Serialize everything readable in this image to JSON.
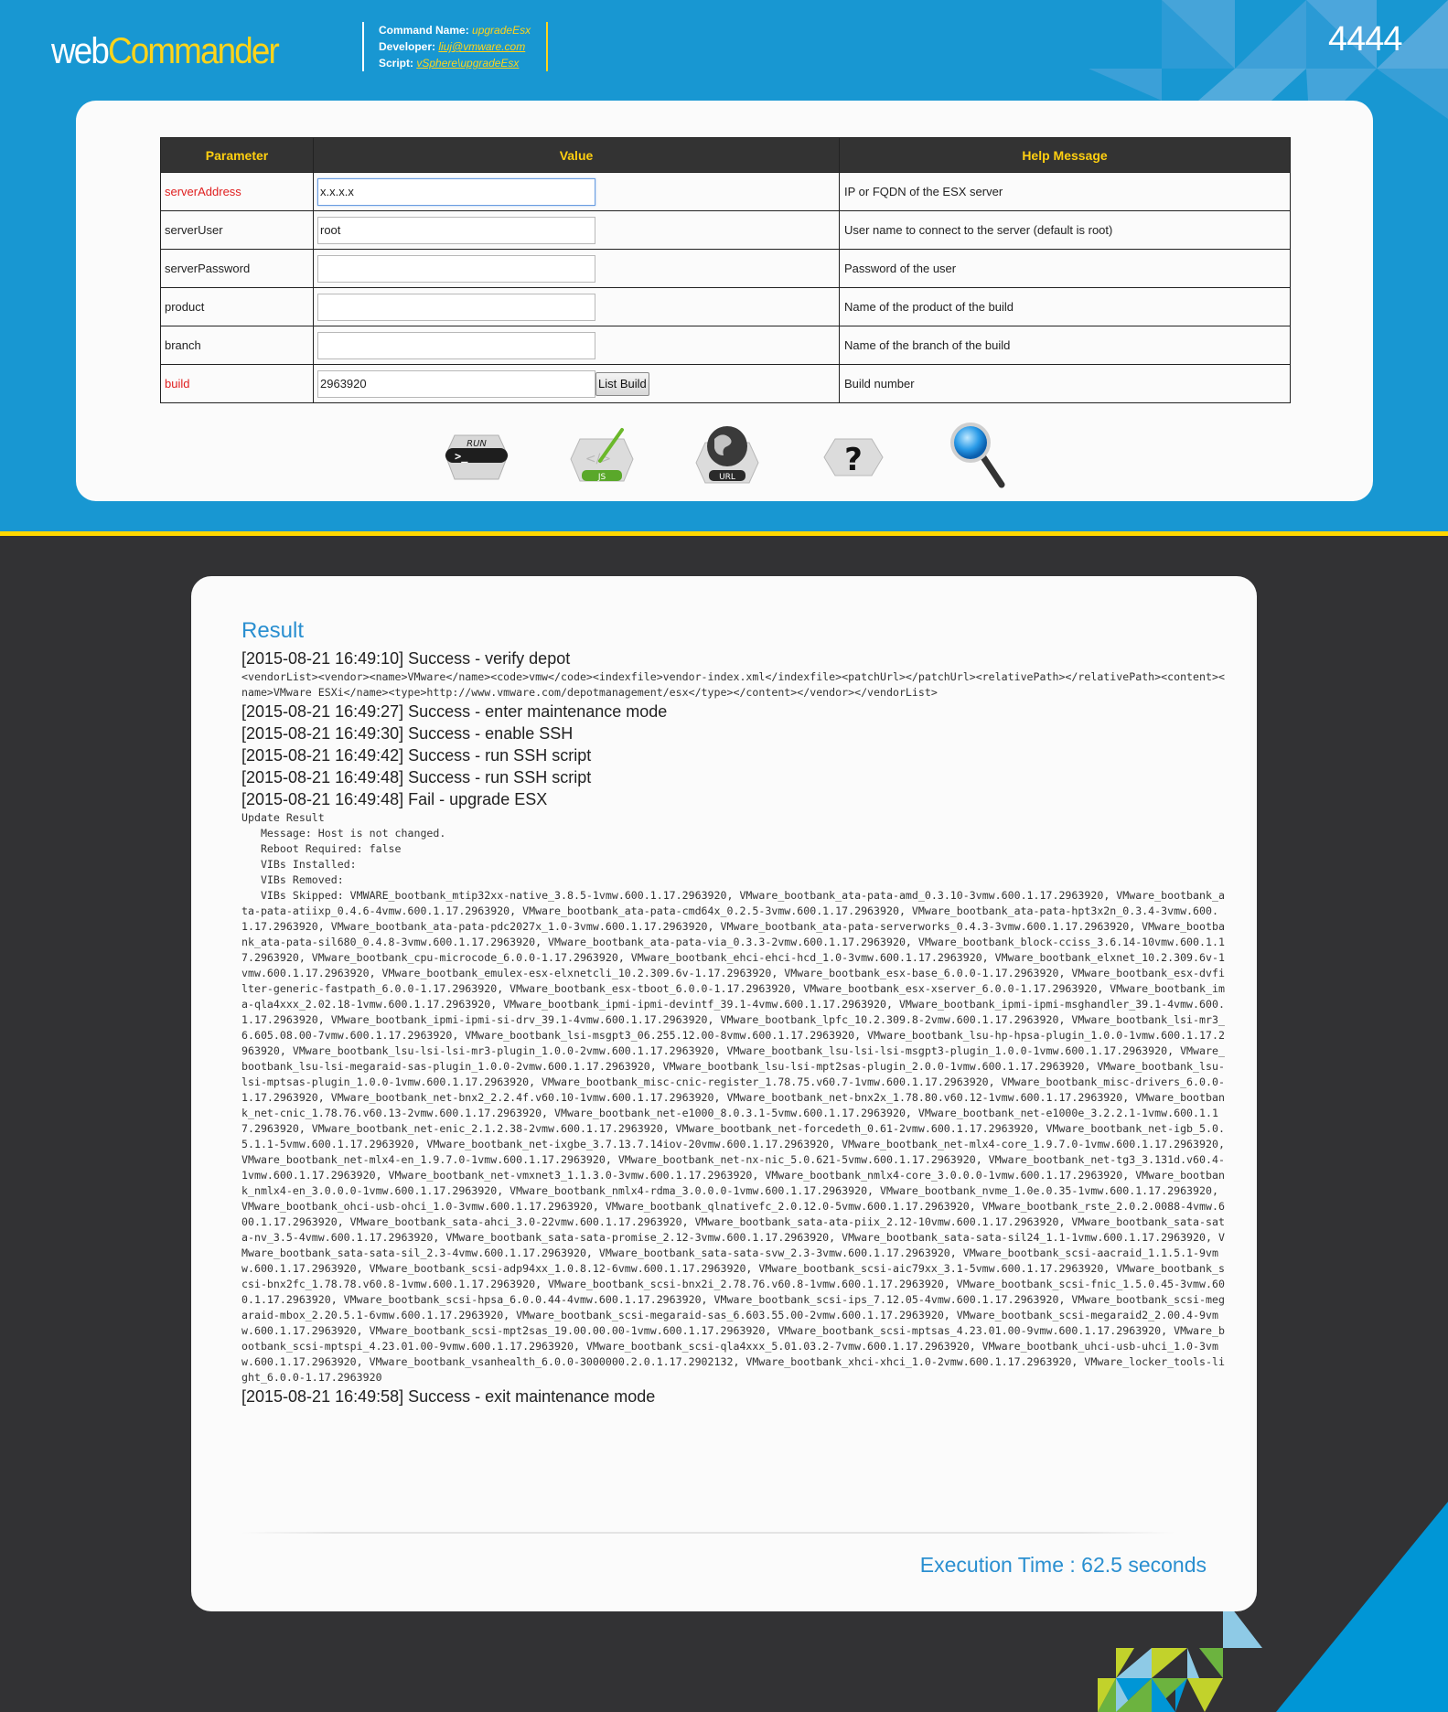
{
  "header": {
    "logo_part1": "web",
    "logo_part2": "Commander",
    "command_name_label": "Command Name: ",
    "command_name": "upgradeEsx",
    "developer_label": "Developer: ",
    "developer": "liuj@vmware.com",
    "script_label": "Script: ",
    "script": "vSphere\\upgradeEsx",
    "job_id": "4444"
  },
  "params": {
    "columns": [
      "Parameter",
      "Value",
      "Help Message"
    ],
    "rows": [
      {
        "name": "serverAddress",
        "required": true,
        "value": "x.x.x.x",
        "help": "IP or FQDN of the ESX server"
      },
      {
        "name": "serverUser",
        "required": false,
        "value": "root",
        "help": "User name to connect to the server (default is root)"
      },
      {
        "name": "serverPassword",
        "required": false,
        "value": "",
        "help": "Password of the user"
      },
      {
        "name": "product",
        "required": false,
        "value": "",
        "help": "Name of the product of the build"
      },
      {
        "name": "branch",
        "required": false,
        "value": "",
        "help": "Name of the branch of the build"
      },
      {
        "name": "build",
        "required": true,
        "value": "2963920",
        "help": "Build number"
      }
    ],
    "list_build_label": "List Build"
  },
  "actions": [
    {
      "name": "run",
      "icon": "run-icon",
      "label": "RUN"
    },
    {
      "name": "js",
      "icon": "js-icon",
      "label": "JS"
    },
    {
      "name": "url",
      "icon": "url-icon",
      "label": "URL"
    },
    {
      "name": "help",
      "icon": "help-icon",
      "label": "?"
    },
    {
      "name": "search",
      "icon": "magnifier-icon",
      "label": ""
    }
  ],
  "colors": {
    "brand_blue": "#1897d2",
    "brand_yellow": "#ffd41a",
    "dark_bg": "#323234",
    "required_red": "#e02020",
    "result_blue": "#2a8fd0"
  },
  "result": {
    "title": "Result",
    "entries": [
      {
        "text": "[2015-08-21 16:49:10] Success - verify depot",
        "detail": "<vendorList><vendor><name>VMware</name><code>vmw</code><indexfile>vendor-index.xml</indexfile><patchUrl></patchUrl><relativePath></relativePath><content><name>VMware ESXi</name><type>http://www.vmware.com/depotmanagement/esx</type></content></vendor></vendorList>"
      },
      {
        "text": "[2015-08-21 16:49:27] Success - enter maintenance mode",
        "detail": ""
      },
      {
        "text": "[2015-08-21 16:49:30] Success - enable SSH",
        "detail": ""
      },
      {
        "text": "[2015-08-21 16:49:42] Success - run SSH script",
        "detail": ""
      },
      {
        "text": "[2015-08-21 16:49:48] Success - run SSH script",
        "detail": ""
      },
      {
        "text": "[2015-08-21 16:49:48] Fail - upgrade ESX",
        "detail": "Update Result\n   Message: Host is not changed.\n   Reboot Required: false\n   VIBs Installed:\n   VIBs Removed:\n   VIBs Skipped: VMWARE_bootbank_mtip32xx-native_3.8.5-1vmw.600.1.17.2963920, VMware_bootbank_ata-pata-amd_0.3.10-3vmw.600.1.17.2963920, VMware_bootbank_ata-pata-atiixp_0.4.6-4vmw.600.1.17.2963920, VMware_bootbank_ata-pata-cmd64x_0.2.5-3vmw.600.1.17.2963920, VMware_bootbank_ata-pata-hpt3x2n_0.3.4-3vmw.600.1.17.2963920, VMware_bootbank_ata-pata-pdc2027x_1.0-3vmw.600.1.17.2963920, VMware_bootbank_ata-pata-serverworks_0.4.3-3vmw.600.1.17.2963920, VMware_bootbank_ata-pata-sil680_0.4.8-3vmw.600.1.17.2963920, VMware_bootbank_ata-pata-via_0.3.3-2vmw.600.1.17.2963920, VMware_bootbank_block-cciss_3.6.14-10vmw.600.1.17.2963920, VMware_bootbank_cpu-microcode_6.0.0-1.17.2963920, VMware_bootbank_ehci-ehci-hcd_1.0-3vmw.600.1.17.2963920, VMware_bootbank_elxnet_10.2.309.6v-1vmw.600.1.17.2963920, VMware_bootbank_emulex-esx-elxnetcli_10.2.309.6v-1.17.2963920, VMware_bootbank_esx-base_6.0.0-1.17.2963920, VMware_bootbank_esx-dvfilter-generic-fastpath_6.0.0-1.17.2963920, VMware_bootbank_esx-tboot_6.0.0-1.17.2963920, VMware_bootbank_esx-xserver_6.0.0-1.17.2963920, VMware_bootbank_ima-qla4xxx_2.02.18-1vmw.600.1.17.2963920, VMware_bootbank_ipmi-ipmi-devintf_39.1-4vmw.600.1.17.2963920, VMware_bootbank_ipmi-ipmi-msghandler_39.1-4vmw.600.1.17.2963920, VMware_bootbank_ipmi-ipmi-si-drv_39.1-4vmw.600.1.17.2963920, VMware_bootbank_lpfc_10.2.309.8-2vmw.600.1.17.2963920, VMware_bootbank_lsi-mr3_6.605.08.00-7vmw.600.1.17.2963920, VMware_bootbank_lsi-msgpt3_06.255.12.00-8vmw.600.1.17.2963920, VMware_bootbank_lsu-hp-hpsa-plugin_1.0.0-1vmw.600.1.17.2963920, VMware_bootbank_lsu-lsi-lsi-mr3-plugin_1.0.0-2vmw.600.1.17.2963920, VMware_bootbank_lsu-lsi-lsi-msgpt3-plugin_1.0.0-1vmw.600.1.17.2963920, VMware_bootbank_lsu-lsi-megaraid-sas-plugin_1.0.0-2vmw.600.1.17.2963920, VMware_bootbank_lsu-lsi-mpt2sas-plugin_2.0.0-1vmw.600.1.17.2963920, VMware_bootbank_lsu-lsi-mptsas-plugin_1.0.0-1vmw.600.1.17.2963920, VMware_bootbank_misc-cnic-register_1.78.75.v60.7-1vmw.600.1.17.2963920, VMware_bootbank_misc-drivers_6.0.0-1.17.2963920, VMware_bootbank_net-bnx2_2.2.4f.v60.10-1vmw.600.1.17.2963920, VMware_bootbank_net-bnx2x_1.78.80.v60.12-1vmw.600.1.17.2963920, VMware_bootbank_net-cnic_1.78.76.v60.13-2vmw.600.1.17.2963920, VMware_bootbank_net-e1000_8.0.3.1-5vmw.600.1.17.2963920, VMware_bootbank_net-e1000e_3.2.2.1-1vmw.600.1.17.2963920, VMware_bootbank_net-enic_2.1.2.38-2vmw.600.1.17.2963920, VMware_bootbank_net-forcedeth_0.61-2vmw.600.1.17.2963920, VMware_bootbank_net-igb_5.0.5.1.1-5vmw.600.1.17.2963920, VMware_bootbank_net-ixgbe_3.7.13.7.14iov-20vmw.600.1.17.2963920, VMware_bootbank_net-mlx4-core_1.9.7.0-1vmw.600.1.17.2963920, VMware_bootbank_net-mlx4-en_1.9.7.0-1vmw.600.1.17.2963920, VMware_bootbank_net-nx-nic_5.0.621-5vmw.600.1.17.2963920, VMware_bootbank_net-tg3_3.131d.v60.4-1vmw.600.1.17.2963920, VMware_bootbank_net-vmxnet3_1.1.3.0-3vmw.600.1.17.2963920, VMware_bootbank_nmlx4-core_3.0.0.0-1vmw.600.1.17.2963920, VMware_bootbank_nmlx4-en_3.0.0.0-1vmw.600.1.17.2963920, VMware_bootbank_nmlx4-rdma_3.0.0.0-1vmw.600.1.17.2963920, VMware_bootbank_nvme_1.0e.0.35-1vmw.600.1.17.2963920, VMware_bootbank_ohci-usb-ohci_1.0-3vmw.600.1.17.2963920, VMware_bootbank_qlnativefc_2.0.12.0-5vmw.600.1.17.2963920, VMware_bootbank_rste_2.0.2.0088-4vmw.600.1.17.2963920, VMware_bootbank_sata-ahci_3.0-22vmw.600.1.17.2963920, VMware_bootbank_sata-ata-piix_2.12-10vmw.600.1.17.2963920, VMware_bootbank_sata-sata-nv_3.5-4vmw.600.1.17.2963920, VMware_bootbank_sata-sata-promise_2.12-3vmw.600.1.17.2963920, VMware_bootbank_sata-sata-sil24_1.1-1vmw.600.1.17.2963920, VMware_bootbank_sata-sata-sil_2.3-4vmw.600.1.17.2963920, VMware_bootbank_sata-sata-svw_2.3-3vmw.600.1.17.2963920, VMware_bootbank_scsi-aacraid_1.1.5.1-9vmw.600.1.17.2963920, VMware_bootbank_scsi-adp94xx_1.0.8.12-6vmw.600.1.17.2963920, VMware_bootbank_scsi-aic79xx_3.1-5vmw.600.1.17.2963920, VMware_bootbank_scsi-bnx2fc_1.78.78.v60.8-1vmw.600.1.17.2963920, VMware_bootbank_scsi-bnx2i_2.78.76.v60.8-1vmw.600.1.17.2963920, VMware_bootbank_scsi-fnic_1.5.0.45-3vmw.600.1.17.2963920, VMware_bootbank_scsi-hpsa_6.0.0.44-4vmw.600.1.17.2963920, VMware_bootbank_scsi-ips_7.12.05-4vmw.600.1.17.2963920, VMware_bootbank_scsi-megaraid-mbox_2.20.5.1-6vmw.600.1.17.2963920, VMware_bootbank_scsi-megaraid-sas_6.603.55.00-2vmw.600.1.17.2963920, VMware_bootbank_scsi-megaraid2_2.00.4-9vmw.600.1.17.2963920, VMware_bootbank_scsi-mpt2sas_19.00.00.00-1vmw.600.1.17.2963920, VMware_bootbank_scsi-mptsas_4.23.01.00-9vmw.600.1.17.2963920, VMware_bootbank_scsi-mptspi_4.23.01.00-9vmw.600.1.17.2963920, VMware_bootbank_scsi-qla4xxx_5.01.03.2-7vmw.600.1.17.2963920, VMware_bootbank_uhci-usb-uhci_1.0-3vmw.600.1.17.2963920, VMware_bootbank_vsanhealth_6.0.0-3000000.2.0.1.17.2902132, VMware_bootbank_xhci-xhci_1.0-2vmw.600.1.17.2963920, VMware_locker_tools-light_6.0.0-1.17.2963920"
      },
      {
        "text": "[2015-08-21 16:49:58] Success - exit maintenance mode",
        "detail": ""
      }
    ],
    "execution_time": "Execution Time : 62.5 seconds"
  }
}
